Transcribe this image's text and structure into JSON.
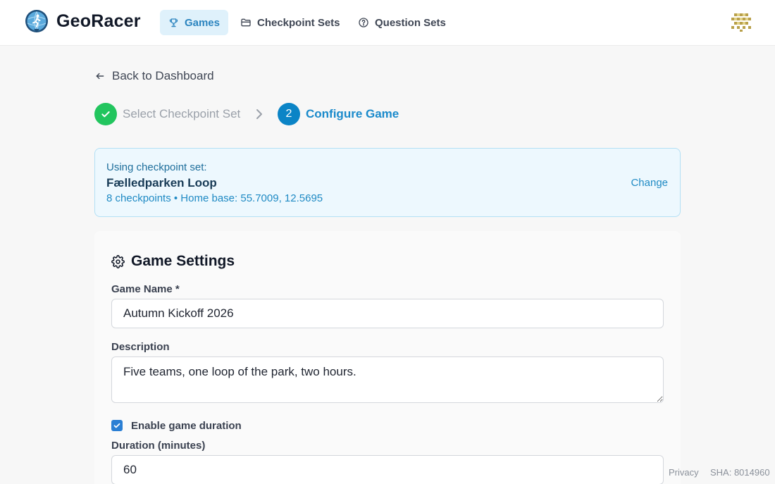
{
  "header": {
    "brand": "GeoRacer",
    "nav": [
      {
        "label": "Games",
        "icon": "trophy-icon",
        "active": true
      },
      {
        "label": "Checkpoint Sets",
        "icon": "folder-icon"
      },
      {
        "label": "Question Sets",
        "icon": "help-circle-icon"
      }
    ],
    "accent_color": "#2b84bf"
  },
  "back_link": "Back to Dashboard",
  "stepper": {
    "steps": [
      {
        "number": "1",
        "label": "Select Checkpoint Set",
        "status": "complete"
      },
      {
        "number": "2",
        "label": "Configure Game",
        "status": "current"
      }
    ]
  },
  "checkpoint_set": {
    "label": "Using checkpoint set:",
    "name": "Fælledparken Loop",
    "meta": "8 checkpoints • Home base: 55.7009, 12.5695",
    "change_label": "Change"
  },
  "settings": {
    "title": "Game Settings",
    "game_name_label": "Game Name *",
    "game_name_value": "Autumn Kickoff 2026",
    "description_label": "Description",
    "description_value": "Five teams, one loop of the park, two hours.",
    "enable_duration_label": "Enable game duration",
    "enable_duration_checked": true,
    "duration_label": "Duration (minutes)",
    "duration_value": "60"
  },
  "footer": {
    "privacy": "Privacy",
    "sha": "SHA: 8014960"
  }
}
